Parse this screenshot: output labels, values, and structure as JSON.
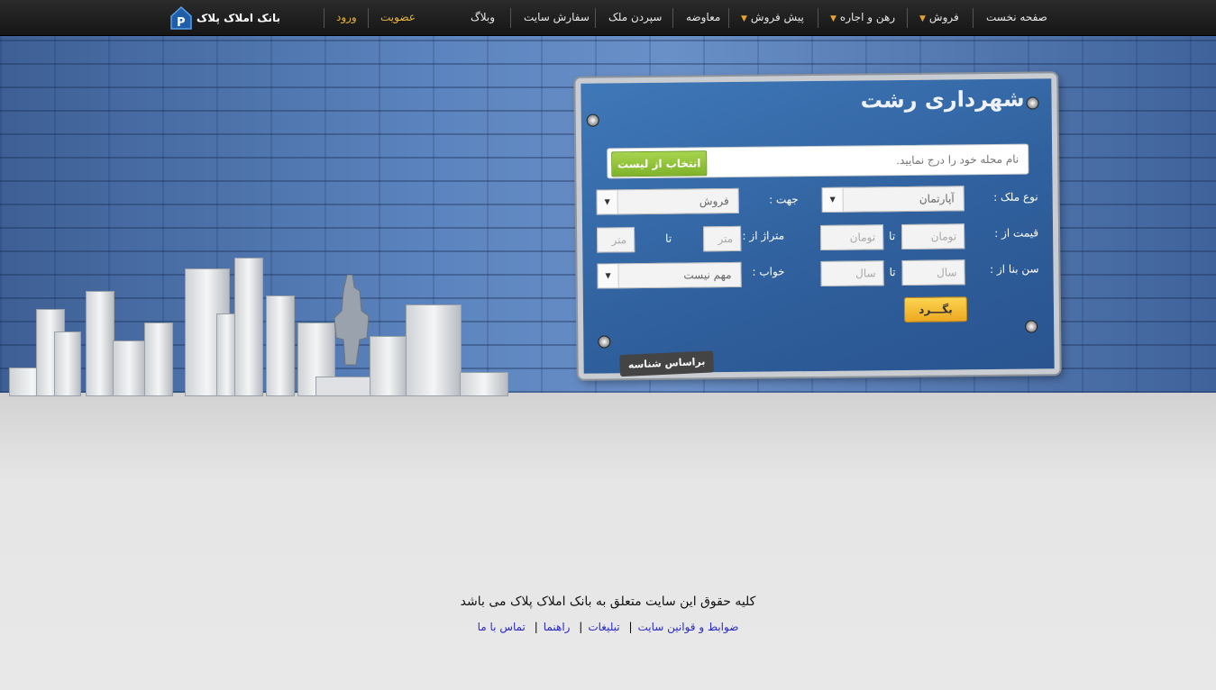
{
  "nav": {
    "items": [
      {
        "label": "صفحه نخست",
        "caret": false
      },
      {
        "label": "فروش",
        "caret": true
      },
      {
        "label": "رهن و اجاره",
        "caret": true
      },
      {
        "label": "پیش فروش",
        "caret": true
      },
      {
        "label": "معاوضه",
        "caret": false
      },
      {
        "label": "سپردن ملک",
        "caret": false
      },
      {
        "label": "سفارش سایت",
        "caret": false
      },
      {
        "label": "وبلاگ",
        "caret": false
      }
    ],
    "signup": "عضویت",
    "login": "ورود",
    "logo_text": "بانک املاک پلاک"
  },
  "sign": {
    "title": "شهرداری رشت",
    "search_placeholder": "نام محله خود را درج نمایید.",
    "search_button": "انتخاب از لیست",
    "property_type_label": "نوع ملک :",
    "property_type_value": "آپارتمان",
    "direction_label": "جهت :",
    "direction_value": "فروش",
    "price_label": "قیمت از :",
    "price_from_placeholder": "تومان",
    "price_to_placeholder": "تومان",
    "area_label": "متراژ از :",
    "area_from_placeholder": "متر",
    "area_to_placeholder": "متر",
    "age_label": "سن بنا از :",
    "age_from_placeholder": "سال",
    "age_to_placeholder": "سال",
    "bedroom_label": "خواب :",
    "bedroom_value": "مهم نیست",
    "to_word": "تا",
    "go_button": "بگـــرد",
    "id_tag": "براساس شناسه"
  },
  "footer": {
    "copyright": "کلیه حقوق این سایت متعلق به بانک املاک پلاک می باشد",
    "links": [
      "ضوابط و قوانین سایت",
      "تبلیغات",
      "راهنما",
      "تماس با ما"
    ]
  },
  "colors": {
    "accent_gold": "#e8b43a",
    "sign_blue": "#2f5f9c",
    "search_green": "#8cbf34",
    "go_yellow": "#f4be36",
    "link_blue": "#2a2ac8"
  }
}
